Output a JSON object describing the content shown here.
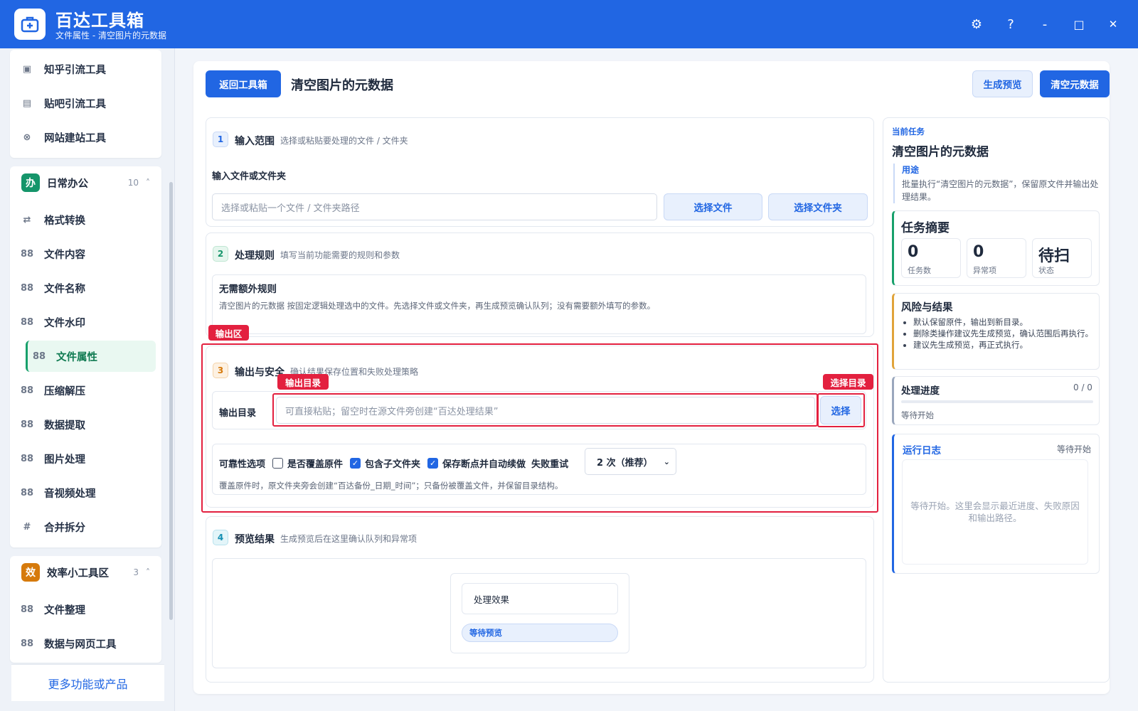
{
  "app": {
    "title": "百达工具箱",
    "subtitle": "文件属性 - 清空图片的元数据"
  },
  "window_controls": {
    "settings": "⚙",
    "help": "?",
    "minimize": "-",
    "maximize": "□",
    "close": "✕"
  },
  "sidebar": {
    "top_items": [
      {
        "label": "知乎引流工具",
        "icon": "▣"
      },
      {
        "label": "贴吧引流工具",
        "icon": "▤"
      },
      {
        "label": "网站建站工具",
        "icon": "⊗"
      }
    ],
    "groups": [
      {
        "badge": "办",
        "title": "日常办公",
        "count": "10",
        "caret": "˄",
        "color": "#15956a",
        "items": [
          {
            "label": "格式转换",
            "icon": "⇄"
          },
          {
            "label": "文件内容",
            "icon": "88"
          },
          {
            "label": "文件名称",
            "icon": "88"
          },
          {
            "label": "文件水印",
            "icon": "88"
          },
          {
            "label": "文件属性",
            "icon": "88"
          },
          {
            "label": "压缩解压",
            "icon": "88"
          },
          {
            "label": "数据提取",
            "icon": "88"
          },
          {
            "label": "图片处理",
            "icon": "88"
          },
          {
            "label": "音视频处理",
            "icon": "88"
          },
          {
            "label": "合并拆分",
            "icon": "#"
          }
        ]
      },
      {
        "badge": "效",
        "title": "效率小工具区",
        "count": "3",
        "caret": "˄",
        "color": "#d67a0c",
        "items": [
          {
            "label": "文件整理",
            "icon": "88"
          },
          {
            "label": "数据与网页工具",
            "icon": "88"
          }
        ]
      }
    ],
    "active": "文件属性",
    "more": "更多功能或产品"
  },
  "header": {
    "back": "返回工具箱",
    "title": "清空图片的元数据",
    "preview": "生成预览",
    "run": "清空元数据"
  },
  "sections": {
    "input": {
      "step": "1",
      "title": "输入范围",
      "desc": "选择或粘贴要处理的文件 / 文件夹",
      "field_label": "输入文件或文件夹",
      "placeholder": "选择或粘贴一个文件 / 文件夹路径",
      "choose_file": "选择文件",
      "choose_folder": "选择文件夹"
    },
    "rules": {
      "step": "2",
      "title": "处理规则",
      "desc": "填写当前功能需要的规则和参数",
      "box_title": "无需额外规则",
      "box_desc": "清空图片的元数据 按固定逻辑处理选中的文件。先选择文件或文件夹，再生成预览确认队列；没有需要额外填写的参数。"
    },
    "output": {
      "step": "3",
      "title": "输出与安全",
      "desc": "确认结果保存位置和失败处理策略",
      "dir_label": "输出目录",
      "dir_placeholder": "可直接粘贴；留空时在源文件旁创建“百达处理结果”",
      "choose": "选择",
      "reliability_label": "可靠性选项",
      "overwrite": "是否覆盖原件",
      "overwrite_checked": false,
      "subfolders": "包含子文件夹",
      "subfolders_checked": true,
      "resume": "保存断点并自动续做",
      "resume_checked": true,
      "retry_label": "失败重试",
      "retry_value": "2 次（推荐）",
      "note": "覆盖原件时，原文件夹旁会创建“百达备份_日期_时间”；只备份被覆盖文件，并保留目录结构。"
    },
    "preview": {
      "step": "4",
      "title": "预览结果",
      "desc": "生成预览后在这里确认队列和异常项",
      "effect": "处理效果",
      "status": "等待预览"
    }
  },
  "annotations": {
    "output_area": "输出区",
    "output_dir": "输出目录",
    "choose_dir": "选择目录"
  },
  "right": {
    "task_label": "当前任务",
    "task_title": "清空图片的元数据",
    "usage_label": "用途",
    "usage_text": "批量执行“清空图片的元数据”，保留原文件并输出处理结果。",
    "summary": {
      "title": "任务摘要",
      "stats": [
        {
          "value": "0",
          "label": "任务数"
        },
        {
          "value": "0",
          "label": "异常项"
        },
        {
          "value": "待扫",
          "label": "状态"
        }
      ]
    },
    "risk": {
      "title": "风险与结果",
      "items": [
        "默认保留原件，输出到新目录。",
        "删除类操作建议先生成预览，确认范围后再执行。",
        "建议先生成预览，再正式执行。"
      ]
    },
    "progress": {
      "title": "处理进度",
      "count": "0 / 0",
      "status": "等待开始",
      "value": 0
    },
    "log": {
      "title": "运行日志",
      "status": "等待开始",
      "placeholder": "等待开始。这里会显示最近进度、失败原因和输出路径。"
    }
  },
  "colors": {
    "primary": "#2166e3",
    "accent_green": "#17a06b",
    "annotation_red": "#e3203f",
    "warning": "#d67a0c"
  }
}
